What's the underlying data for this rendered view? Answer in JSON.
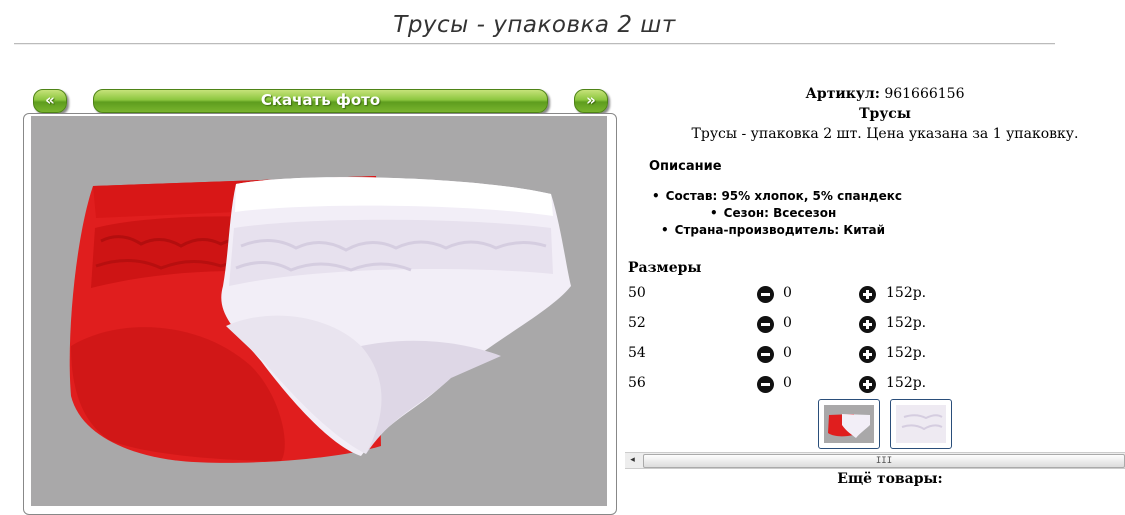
{
  "page": {
    "title": "Трусы - упаковка 2 шт"
  },
  "gallery": {
    "prev_label": "«",
    "download_label": "Скачать фото",
    "next_label": "»"
  },
  "product": {
    "article_label": "Артикул:",
    "article_value": "961666156",
    "name": "Трусы",
    "short_desc": "Трусы - упаковка 2 шт. Цена указана за 1 упаковку.",
    "description_header": "Описание",
    "properties": [
      "Состав: 95% хлопок, 5% спандекс",
      "Сезон: Всесезон",
      "Страна-производитель: Китай"
    ]
  },
  "sizes": {
    "header": "Размеры",
    "rows": [
      {
        "size": "50",
        "qty": "0",
        "price": "152р."
      },
      {
        "size": "52",
        "qty": "0",
        "price": "152р."
      },
      {
        "size": "54",
        "qty": "0",
        "price": "152р."
      },
      {
        "size": "56",
        "qty": "0",
        "price": "152р."
      }
    ]
  },
  "scrollbar": {
    "left_arrow": "◂",
    "grip": "III"
  },
  "more": {
    "header": "Ещё товары:"
  },
  "icons": {
    "minus": "minus-circle-icon",
    "plus": "plus-circle-icon"
  },
  "colors": {
    "button_green": "#8cc63f",
    "photo_bg": "#a9a8a9",
    "link_green": "#1d6f1d"
  }
}
